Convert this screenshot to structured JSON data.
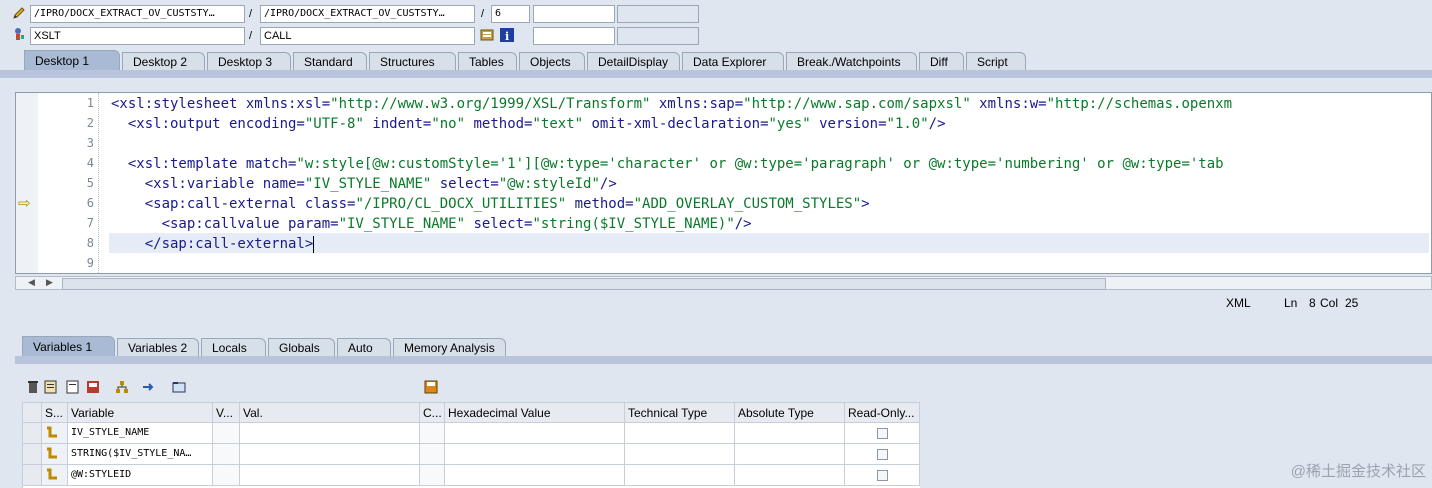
{
  "header": {
    "row1": {
      "field1": "/IPRO/DOCX_EXTRACT_OV_CUSTSTY…",
      "sep1": "/",
      "field2": "/IPRO/DOCX_EXTRACT_OV_CUSTSTY…",
      "sep2": "/",
      "field3": "6"
    },
    "row2": {
      "field1": "XSLT",
      "sep1": "/",
      "field2": "CALL"
    }
  },
  "desktop_tabs": [
    "Desktop 1",
    "Desktop 2",
    "Desktop 3",
    "Standard",
    "Structures",
    "Tables",
    "Objects",
    "DetailDisplay",
    "Data Explorer",
    "Break./Watchpoints",
    "Diff",
    "Script"
  ],
  "editor": {
    "line_numbers": [
      "1",
      "2",
      "3",
      "4",
      "5",
      "6",
      "7",
      "8",
      "9"
    ],
    "current_line_arrow": "⇨"
  },
  "status_bar": {
    "lang": "XML",
    "ln_label": "Ln",
    "ln": "8",
    "col_label": "Col",
    "col": "25"
  },
  "variable_tabs": [
    "Variables 1",
    "Variables 2",
    "Locals",
    "Globals",
    "Auto",
    "Memory Analysis"
  ],
  "table": {
    "headers": [
      "S...",
      "Variable",
      "V...",
      "Val.",
      "C...",
      "Hexadecimal Value",
      "Technical Type",
      "Absolute Type",
      "Read-Only..."
    ],
    "rows": [
      {
        "variable": "IV_STYLE_NAME"
      },
      {
        "variable": "STRING($IV_STYLE_NA…"
      },
      {
        "variable": "@W:STYLEID"
      }
    ]
  },
  "watermark": "@稀土掘金技术社区"
}
